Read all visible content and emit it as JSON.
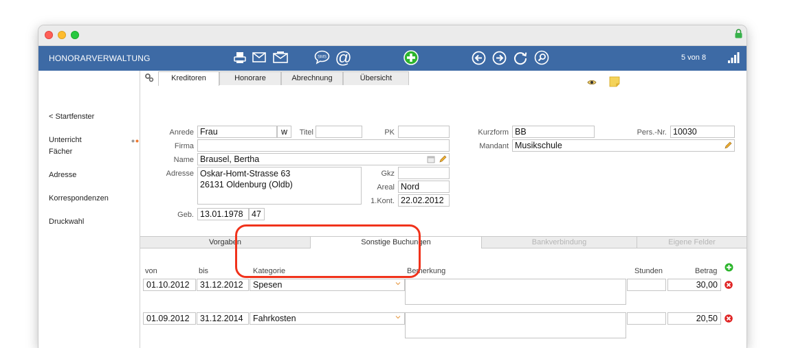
{
  "toolbar": {
    "title": "HONORARVERWALTUNG",
    "counter": "5 von 8",
    "icons": [
      "printer-icon",
      "mail-icon",
      "mail-open-icon",
      "sms-icon",
      "at-icon",
      "add-icon",
      "back-icon",
      "forward-icon",
      "refresh-icon",
      "search-icon",
      "stats-icon"
    ],
    "sms_label": "SMS",
    "at_label": "@"
  },
  "sidebar": {
    "items": [
      "< Startfenster",
      "Unterricht",
      "Fächer",
      "Adresse",
      "Korrespondenzen",
      "Druckwahl"
    ]
  },
  "tabs": [
    "Kreditoren",
    "Honorare",
    "Abrechnung",
    "Übersicht"
  ],
  "active_tab": "Kreditoren",
  "form": {
    "anrede_label": "Anrede",
    "anrede": "Frau",
    "geschlecht": "w",
    "titel_label": "Titel",
    "titel": "",
    "pk_label": "PK",
    "pk": "",
    "kurzform_label": "Kurzform",
    "kurzform": "BB",
    "persnr_label": "Pers.-Nr.",
    "persnr": "10030",
    "firma_label": "Firma",
    "firma": "",
    "mandant_label": "Mandant",
    "mandant": "Musikschule",
    "name_label": "Name",
    "name": "Brausel, Bertha",
    "adresse_label": "Adresse",
    "adresse_line1": "Oskar-Homt-Strasse 63",
    "adresse_line2": "26131 Oldenburg (Oldb)",
    "gkz_label": "Gkz",
    "gkz": "",
    "areal_label": "Areal",
    "areal": "Nord",
    "kont_label": "1.Kont.",
    "kont": "22.02.2012",
    "geb_label": "Geb.",
    "geb": "13.01.1978",
    "alter": "47"
  },
  "subtabs": [
    "Vorgaben",
    "Sonstige Buchungen",
    "Bankverbindung",
    "Eigene Felder"
  ],
  "active_subtab": "Sonstige Buchungen",
  "bookings": {
    "headers": {
      "von": "von",
      "bis": "bis",
      "kategorie": "Kategorie",
      "bemerkung": "Bemerkung",
      "stunden": "Stunden",
      "betrag": "Betrag"
    },
    "rows": [
      {
        "von": "01.10.2012",
        "bis": "31.12.2012",
        "kategorie": "Spesen",
        "bemerkung": "",
        "stunden": "",
        "betrag": "30,00"
      },
      {
        "von": "01.09.2012",
        "bis": "31.12.2014",
        "kategorie": "Fahrkosten",
        "bemerkung": "",
        "stunden": "",
        "betrag": "20,50"
      }
    ]
  },
  "colors": {
    "toolbar_bg": "#3d6aa5",
    "highlight": "#f0321b",
    "add_green": "#2db52d",
    "delete_red": "#e02424"
  }
}
